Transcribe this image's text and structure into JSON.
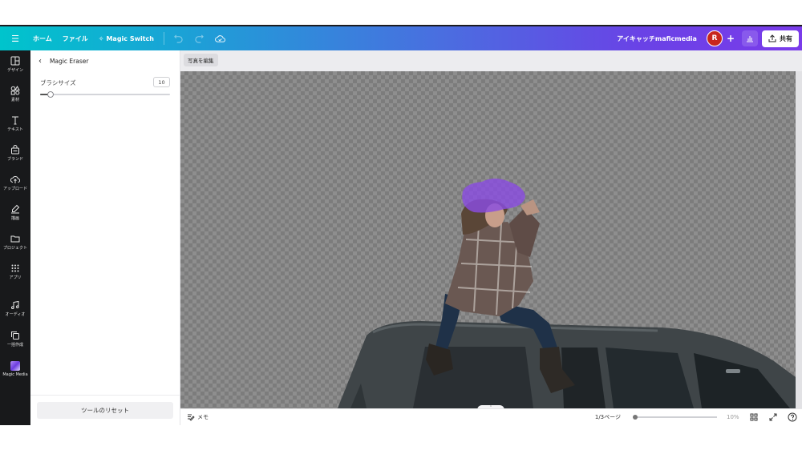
{
  "topbar": {
    "menu_icon": "hamburger-icon",
    "home_label": "ホーム",
    "file_label": "ファイル",
    "magic_switch_label": "Magic Switch",
    "team_label": "アイキャッチmaficmedia",
    "avatar_initial": "R",
    "share_label": "共有"
  },
  "rail": {
    "items": [
      {
        "label": "デザイン",
        "icon": "layout-icon"
      },
      {
        "label": "素材",
        "icon": "shapes-icon"
      },
      {
        "label": "テキスト",
        "icon": "text-icon"
      },
      {
        "label": "ブランド",
        "icon": "brand-icon"
      },
      {
        "label": "アップロード",
        "icon": "cloud-upload-icon"
      },
      {
        "label": "描画",
        "icon": "pen-icon"
      },
      {
        "label": "プロジェクト",
        "icon": "folder-icon"
      },
      {
        "label": "アプリ",
        "icon": "grid-icon"
      },
      {
        "label": "オーディオ",
        "icon": "music-icon"
      },
      {
        "label": "一括作成",
        "icon": "bulk-create-icon"
      },
      {
        "label": "Magic Media",
        "icon": "magic-media-icon"
      }
    ]
  },
  "panel": {
    "title": "Magic Eraser",
    "brush_size_label": "ブラシサイズ",
    "brush_size_value": "10",
    "brush_size_fraction": 0.08,
    "reset_label": "ツールのリセット"
  },
  "workspace": {
    "edit_photo_label": "写真を編集"
  },
  "bottombar": {
    "memo_label": "メモ",
    "page_indicator": "1/3ページ",
    "zoom_value": "10%",
    "zoom_fraction": 0.02
  },
  "colors": {
    "topbar_start": "#00c4cc",
    "topbar_end": "#7a3bea",
    "rail_bg": "#18191b",
    "eraser_highlight": "#8a4de0",
    "avatar": "#c8261f"
  }
}
